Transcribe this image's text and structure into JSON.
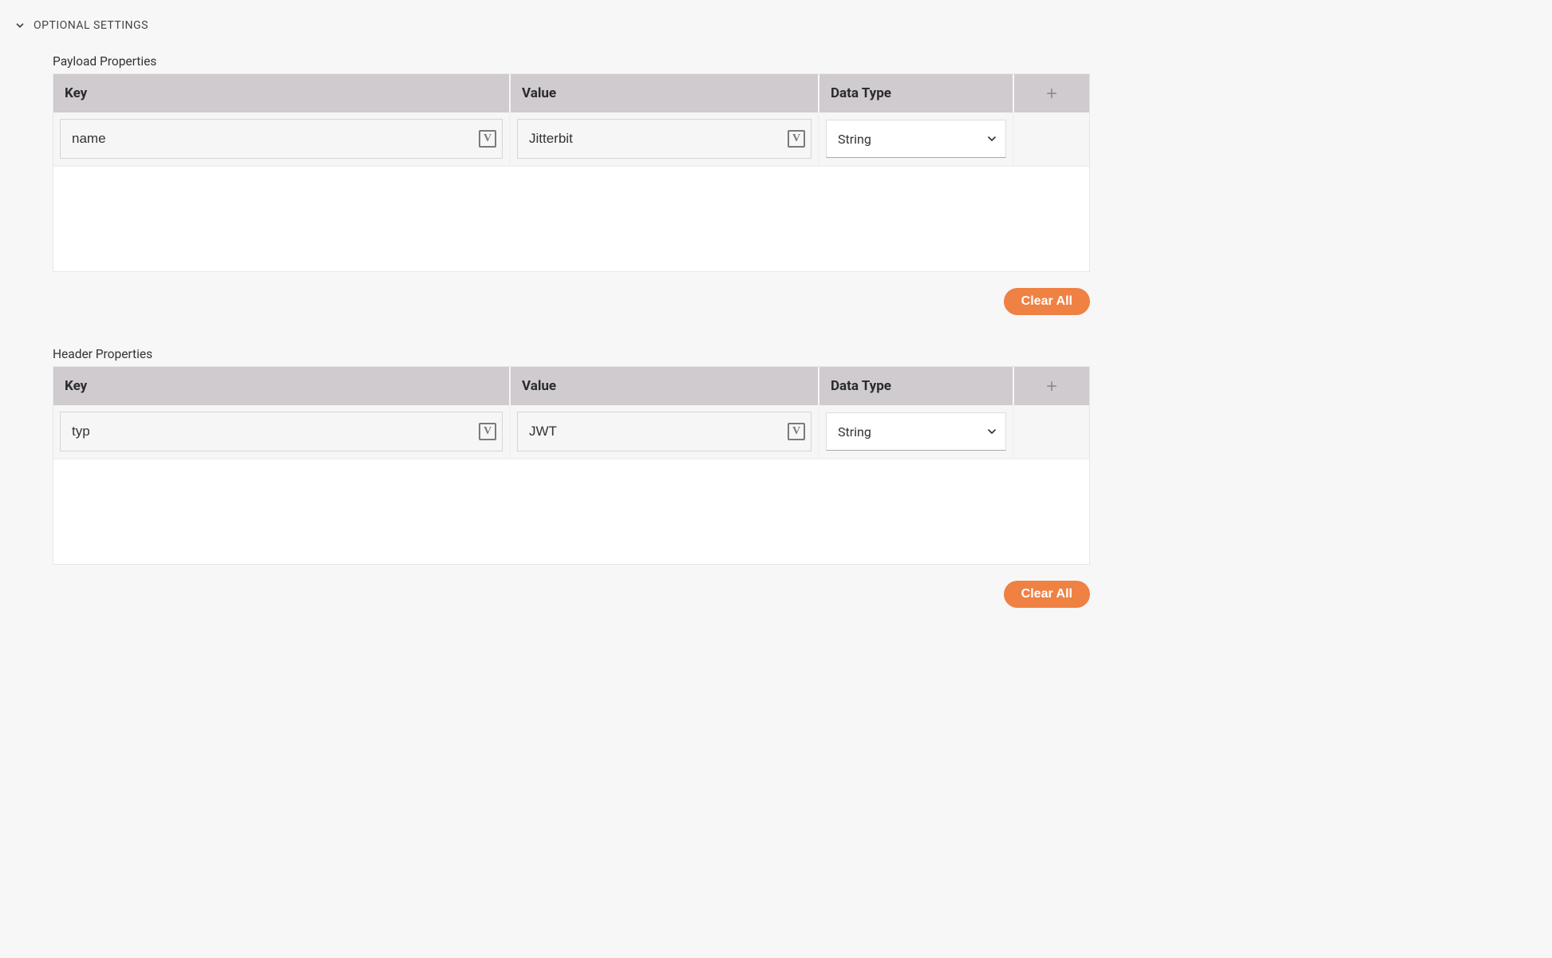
{
  "section": {
    "title": "OPTIONAL SETTINGS"
  },
  "payload": {
    "label": "Payload Properties",
    "columns": {
      "key": "Key",
      "value": "Value",
      "dataType": "Data Type"
    },
    "rows": [
      {
        "key": "name",
        "value": "Jitterbit",
        "dataType": "String"
      }
    ],
    "clear": "Clear All"
  },
  "header": {
    "label": "Header Properties",
    "columns": {
      "key": "Key",
      "value": "Value",
      "dataType": "Data Type"
    },
    "rows": [
      {
        "key": "typ",
        "value": "JWT",
        "dataType": "String"
      }
    ],
    "clear": "Clear All"
  },
  "icons": {
    "variable": "V"
  }
}
